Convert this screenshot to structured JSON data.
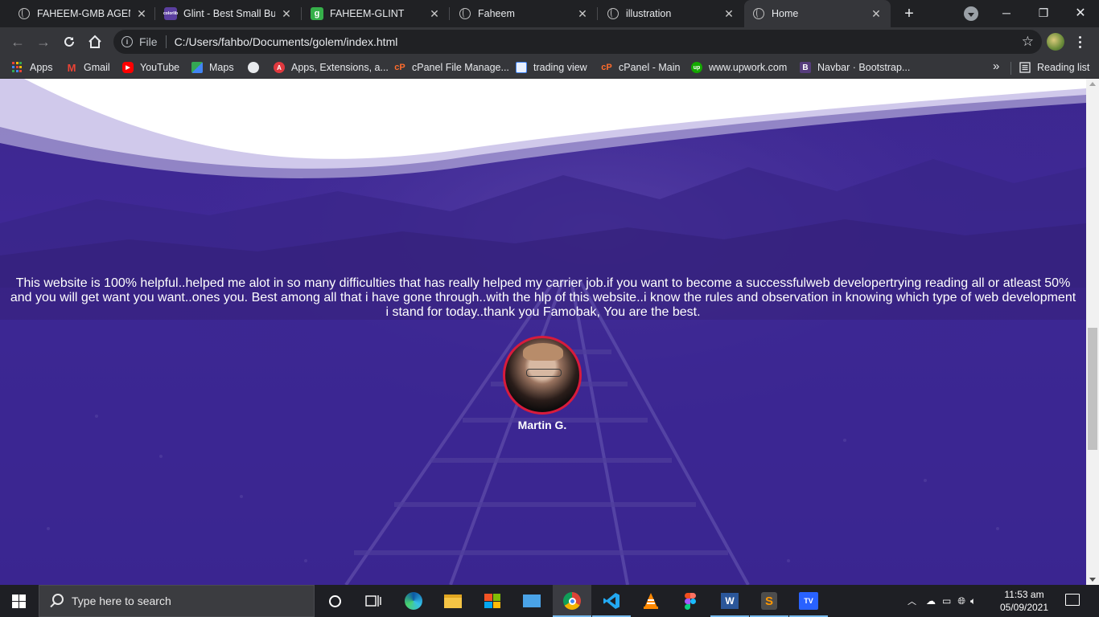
{
  "browser": {
    "tabs": [
      {
        "title": "FAHEEM-GMB AGENCY",
        "icon": "globe-icon",
        "active": false
      },
      {
        "title": "Glint - Best Small Business",
        "icon": "colorlib-icon",
        "active": false
      },
      {
        "title": "FAHEEM-GLINT",
        "icon": "glitch-icon",
        "active": false
      },
      {
        "title": "Faheem",
        "icon": "globe-icon",
        "active": false
      },
      {
        "title": "illustration",
        "icon": "globe-icon",
        "active": false
      },
      {
        "title": "Home",
        "icon": "globe-icon",
        "active": true
      }
    ],
    "address": {
      "scheme_label": "File",
      "url": "C:/Users/fahbo/Documents/golem/index.html"
    },
    "bookmarks": [
      {
        "label": "Apps",
        "icon": "apps-grid-icon"
      },
      {
        "label": "Gmail",
        "icon": "gmail-icon"
      },
      {
        "label": "YouTube",
        "icon": "youtube-icon"
      },
      {
        "label": "Maps",
        "icon": "maps-icon"
      },
      {
        "label": "",
        "icon": "globe-icon"
      },
      {
        "label": "Apps, Extensions, a...",
        "icon": "adobe-icon"
      },
      {
        "label": "cPanel File Manage...",
        "icon": "cpanel-icon"
      },
      {
        "label": "trading view",
        "icon": "image-icon"
      },
      {
        "label": "cPanel - Main",
        "icon": "cpanel-icon"
      },
      {
        "label": "www.upwork.com",
        "icon": "upwork-icon"
      },
      {
        "label": "Navbar · Bootstrap...",
        "icon": "bootstrap-icon"
      }
    ],
    "overflow_label": "»",
    "reading_list": "Reading list"
  },
  "page": {
    "testimonial": "This website is 100% helpful..helped me alot in so many difficulties that has really helped my carrier job.if you want to become a successfulweb developertrying reading all or atleast 50% and you will get want you want..ones you. Best among all that i have gone through..with the hlp of this website..i know the rules and observation in knowing which type of web development i stand for today..thank you Famobak, You are the best.",
    "author": "Martin G.",
    "accent_color": "#3a2490",
    "avatar_border": "#d81b3c"
  },
  "taskbar": {
    "search_placeholder": "Type here to search",
    "time": "11:53 am",
    "date": "05/09/2021"
  }
}
